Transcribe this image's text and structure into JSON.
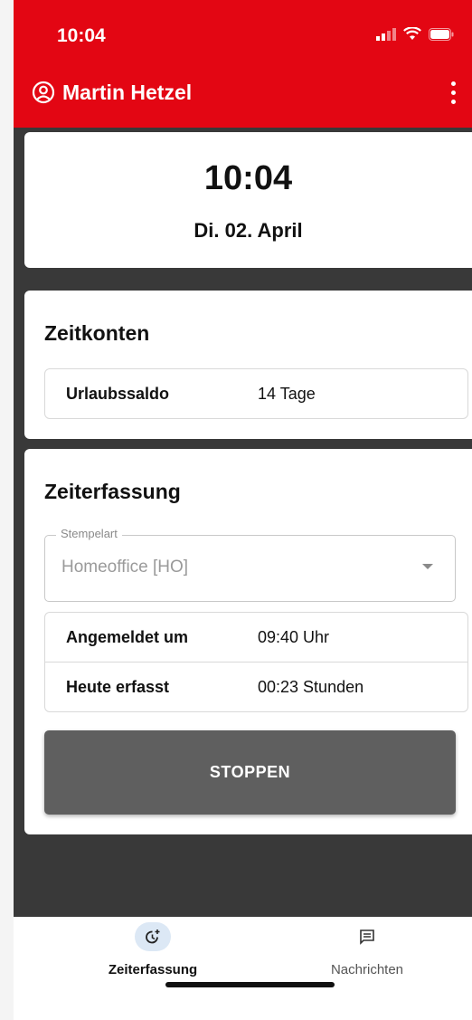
{
  "status_bar": {
    "time": "10:04"
  },
  "app_bar": {
    "user_name": "Martin Hetzel",
    "accent": "#e30613"
  },
  "clock": {
    "time": "10:04",
    "date": "Di. 02. April"
  },
  "zeitkonten": {
    "title": "Zeitkonten",
    "rows": [
      {
        "label": "Urlaubssaldo",
        "value": "14 Tage"
      }
    ]
  },
  "zeiterfassung": {
    "title": "Zeiterfassung",
    "stempelart": {
      "label": "Stempelart",
      "value": "Homeoffice [HO]"
    },
    "rows": [
      {
        "label": "Angemeldet um",
        "value": "09:40 Uhr"
      },
      {
        "label": "Heute erfasst",
        "value": "00:23 Stunden"
      }
    ],
    "button_label": "STOPPEN"
  },
  "bottom_nav": {
    "items": [
      {
        "label": "Zeiterfassung",
        "icon": "clock-plus-icon",
        "active": true
      },
      {
        "label": "Nachrichten",
        "icon": "message-icon",
        "active": false
      }
    ]
  }
}
